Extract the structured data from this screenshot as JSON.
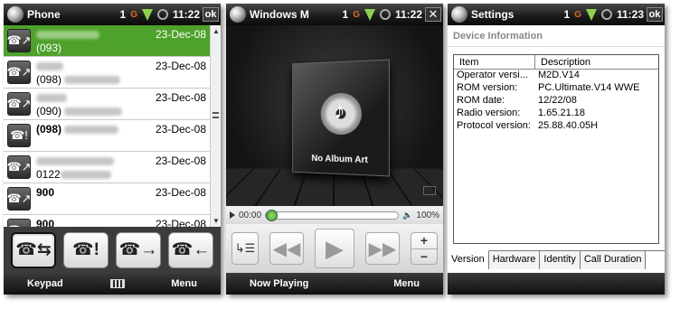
{
  "status": {
    "signal_count": "1",
    "sim": "G"
  },
  "phone": {
    "title": "Phone",
    "time": "11:22",
    "ok": "ok",
    "calls": [
      {
        "icon": "outgoing-call",
        "number": "(093)",
        "date": "23-Dec-08",
        "selected": true
      },
      {
        "icon": "outgoing-call",
        "number": "(098)",
        "date": "23-Dec-08"
      },
      {
        "icon": "outgoing-call",
        "number": "(090)",
        "date": "23-Dec-08"
      },
      {
        "icon": "missed-call",
        "number": "(098)",
        "date": "23-Dec-08"
      },
      {
        "icon": "outgoing-call",
        "number": "0122",
        "date": "23-Dec-08"
      },
      {
        "icon": "outgoing-call",
        "number": "900",
        "date": "23-Dec-08"
      },
      {
        "icon": "outgoing-call",
        "number": "900",
        "date": "23-Dec-08"
      }
    ],
    "filters": [
      "all-calls",
      "missed-calls",
      "outgoing-calls",
      "incoming-calls"
    ],
    "softkeys": {
      "left": "Keypad",
      "right": "Menu"
    }
  },
  "player": {
    "title": "Windows M",
    "time": "11:22",
    "album_art_text": "No Album Art",
    "elapsed": "00:00",
    "volume": "100%",
    "softkeys": {
      "left": "Now Playing",
      "right": "Menu"
    }
  },
  "settings": {
    "title": "Settings",
    "time": "11:23",
    "ok": "ok",
    "section": "Device Information",
    "headers": [
      "Item",
      "Description"
    ],
    "rows": [
      {
        "item": "Operator versi...",
        "value": "M2D.V14"
      },
      {
        "item": "ROM version:",
        "value": "PC.Ultimate.V14 WWE"
      },
      {
        "item": "ROM date:",
        "value": "12/22/08"
      },
      {
        "item": "Radio version:",
        "value": "1.65.21.18"
      },
      {
        "item": "Protocol version:",
        "value": "25.88.40.05H"
      }
    ],
    "tabs": [
      "Version",
      "Hardware",
      "Identity",
      "Call Duration"
    ]
  }
}
